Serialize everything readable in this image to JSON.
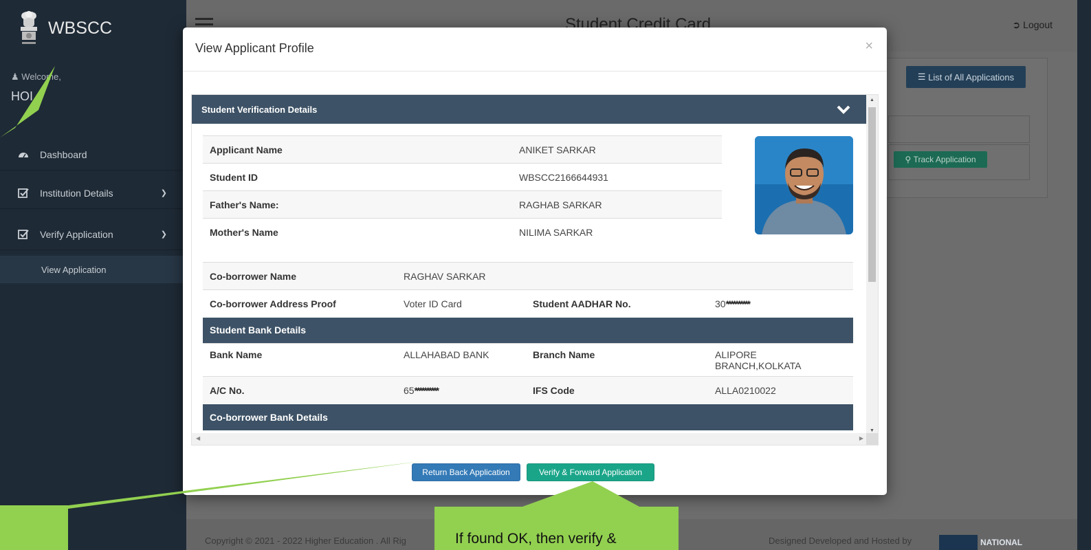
{
  "app": {
    "brand": "WBSCC",
    "page_title": "Student Credit Card",
    "logout_label": "Logout"
  },
  "sidebar": {
    "welcome": "Welcome,",
    "user_name": "HOI",
    "items": [
      {
        "label": "Dashboard",
        "icon": "dashboard-icon"
      },
      {
        "label": "Institution Details",
        "icon": "checkbox-icon"
      },
      {
        "label": "Verify Application",
        "icon": "checkbox-icon"
      }
    ],
    "sub_item": "View Application"
  },
  "background": {
    "list_button": "List of All Applications",
    "track_button": "Track Application",
    "footer_left": "Copyright © 2021 - 2022 Higher Education . All Rig",
    "footer_right": "Designed Developed and Hosted by",
    "nic_text": "NATIONAL"
  },
  "modal": {
    "title": "View Applicant Profile",
    "close": "×",
    "panel_title": "Student Verification Details",
    "details": [
      {
        "label": "Applicant Name",
        "value": "ANIKET SARKAR"
      },
      {
        "label": "Student ID",
        "value": "WBSCC2166644931"
      },
      {
        "label": "Father's Name:",
        "value": "RAGHAB SARKAR"
      },
      {
        "label": "Mother's Name",
        "value": "NILIMA SARKAR"
      }
    ],
    "coborrower_name_label": "Co-borrower Name",
    "coborrower_name": "RAGHAV SARKAR",
    "coborrower_proof_label": "Co-borrower Address Proof",
    "coborrower_proof": "Voter ID Card",
    "aadhar_label": "Student AADHAR No.",
    "aadhar_prefix": "30",
    "aadhar_mask": "**********",
    "bank_section": "Student Bank Details",
    "bank_name_label": "Bank Name",
    "bank_name": "ALLAHABAD BANK",
    "branch_label": "Branch Name",
    "branch_line1": "ALIPORE",
    "branch_line2": "BRANCH,KOLKATA",
    "ac_label": "A/C No.",
    "ac_prefix": "65",
    "ac_mask": "**********",
    "ifs_label": "IFS Code",
    "ifs": "ALLA0210022",
    "coborrower_bank_section": "Co-borrower Bank Details",
    "return_button": "Return Back Application",
    "verify_button": "Verify & Forward Application"
  },
  "annotation": {
    "middle_text": "If found OK, then verify &"
  },
  "colors": {
    "sidebar": "#1e2a36",
    "panel_header": "#3d5266",
    "return_button": "#337ab7",
    "verify_button": "#1aa589",
    "callout": "#92d050"
  }
}
